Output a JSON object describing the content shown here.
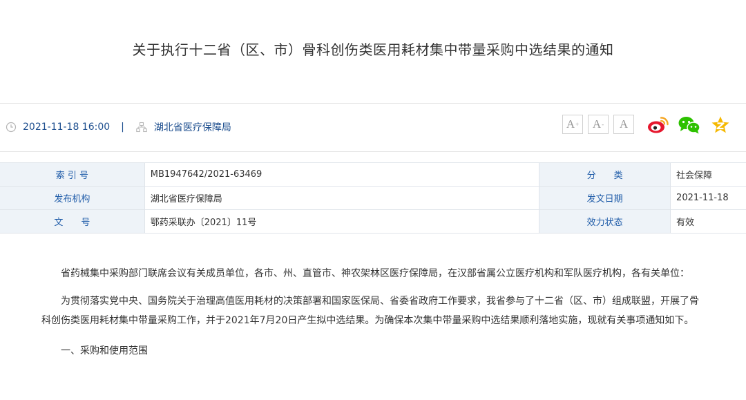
{
  "article": {
    "title": "关于执行十二省（区、市）骨科创伤类医用耗材集中带量采购中选结果的通知",
    "date": "2021-11-18 16:00",
    "separator": "|",
    "source": "湖北省医疗保障局"
  },
  "font_controls": [
    {
      "label": "A",
      "sup": "+"
    },
    {
      "label": "A",
      "sup": "-"
    },
    {
      "label": "A",
      "sup": ""
    }
  ],
  "share_icons": [
    "weibo-icon",
    "wechat-icon",
    "favorite-star-icon"
  ],
  "info_table": {
    "rows": [
      {
        "label1": "索 引 号",
        "value1": "MB1947642/2021-63469",
        "label2": "分　　类",
        "value2": "社会保障"
      },
      {
        "label1": "发布机构",
        "value1": "湖北省医疗保障局",
        "label2": "发文日期",
        "value2": "2021-11-18"
      },
      {
        "label1": "文　　号",
        "value1": "鄂药采联办〔2021〕11号",
        "label2": "效力状态",
        "value2": "有效"
      }
    ]
  },
  "body": {
    "p1": "省药械集中采购部门联席会议有关成员单位，各市、州、直管市、神农架林区医疗保障局，在汉部省属公立医疗机构和军队医疗机构，各有关单位：",
    "p2": "为贯彻落实党中央、国务院关于治理高值医用耗材的决策部署和国家医保局、省委省政府工作要求，我省参与了十二省（区、市）组成联盟，开展了骨科创伤类医用耗材集中带量采购工作，并于2021年7月20日产生拟中选结果。为确保本次集中带量采购中选结果顺利落地实施，现就有关事项通知如下。",
    "h1": "一、采购和使用范围"
  },
  "colors": {
    "link_blue": "#1e4f8f",
    "label_blue": "#1e5ba8",
    "label_bg": "#eef3f8",
    "weibo_red": "#e6162d",
    "weibo_orange": "#f5a623",
    "wechat_green": "#2dc100",
    "star_yellow": "#f5b800"
  }
}
